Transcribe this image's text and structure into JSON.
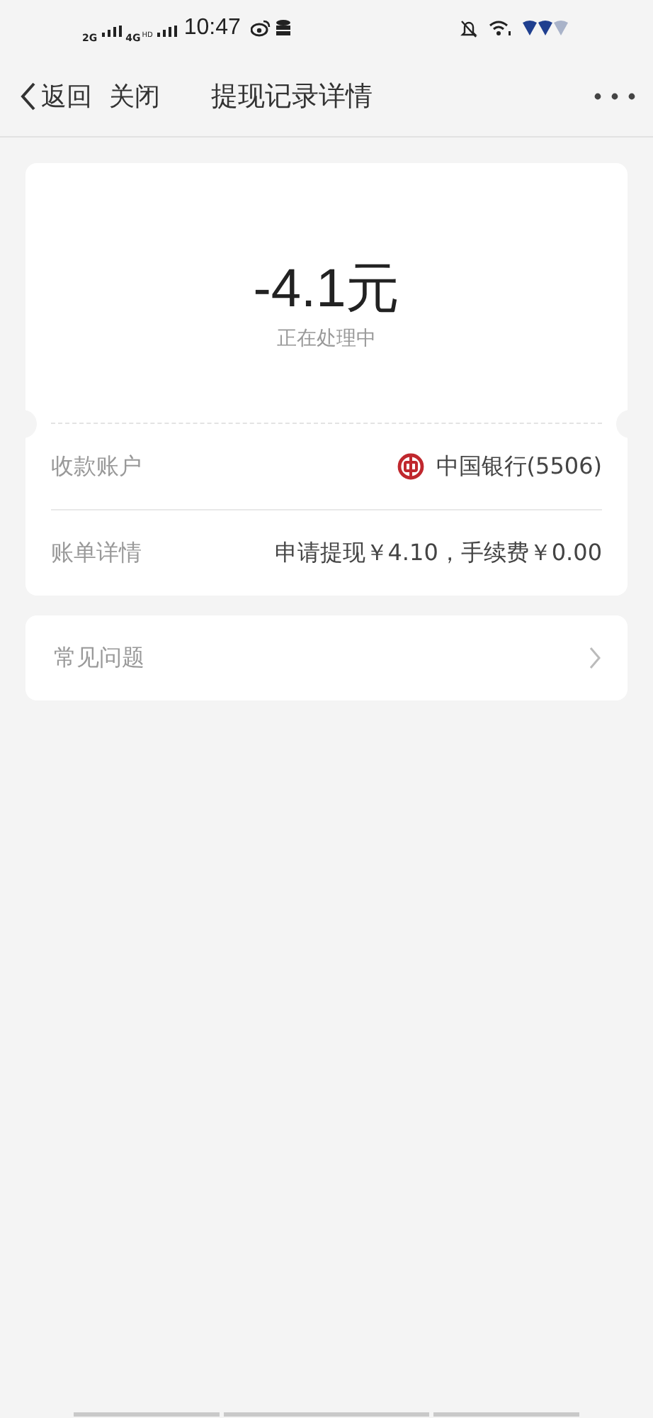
{
  "status_bar": {
    "network_1": "2G",
    "network_2": "4G",
    "network_2_badge": "HD",
    "time": "10:47"
  },
  "nav": {
    "back": "返回",
    "close": "关闭",
    "title": "提现记录详情"
  },
  "summary": {
    "amount": "-4.1元",
    "status": "正在处理中"
  },
  "details": [
    {
      "label": "收款账户",
      "value": "中国银行(5506)",
      "kind": "bank"
    },
    {
      "label": "账单详情",
      "value": "申请提现￥4.10，手续费￥0.00",
      "kind": "text"
    }
  ],
  "faq": {
    "label": "常见问题"
  }
}
